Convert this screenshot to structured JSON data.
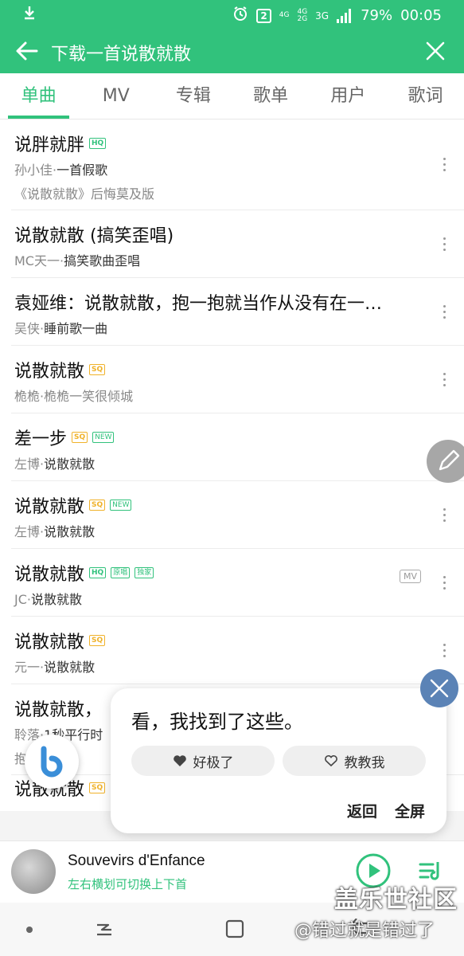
{
  "status_bar": {
    "icons": [
      "download-icon",
      "alarm-icon",
      "sim-icon",
      "signal-icon"
    ],
    "sim_badge": "2",
    "net1_top": "4G",
    "net1_bottom": "",
    "net2_top": "4G",
    "net2_bottom": "2G",
    "net3": "3G",
    "battery": "79%",
    "time": "00:05"
  },
  "header": {
    "title": "下载一首说散就散",
    "accent_color": "#31c27c"
  },
  "tabs": [
    {
      "label": "单曲",
      "active": true
    },
    {
      "label": "MV"
    },
    {
      "label": "专辑"
    },
    {
      "label": "歌单"
    },
    {
      "label": "用户"
    },
    {
      "label": "歌词"
    }
  ],
  "songs": [
    {
      "title": "说胖就胖",
      "tags": [
        "HQ"
      ],
      "artist": "孙小佳·",
      "album": "一首假歌",
      "extra": "《说散就散》后悔莫及版"
    },
    {
      "title": "说散就散 (搞笑歪唱)",
      "tags": [],
      "artist": "MC天一·",
      "album": "搞笑歌曲歪唱"
    },
    {
      "title": "袁娅维：说散就散，抱一抱就当作从没有在一…",
      "tags": [],
      "artist": "吴侠·",
      "album": "睡前歌一曲"
    },
    {
      "title": "说散就散",
      "tags": [
        "SQ"
      ],
      "artist": "桅桅·",
      "album": "桅桅一笑很倾城"
    },
    {
      "title": "差一步",
      "tags": [
        "SQ",
        "NEW"
      ],
      "artist": "左博·",
      "album": "说散就散"
    },
    {
      "title": "说散就散",
      "tags": [
        "SQ",
        "NEW"
      ],
      "artist": "左博·",
      "album": "说散就散"
    },
    {
      "title": "说散就散",
      "tags": [
        "HQ",
        "原唱",
        "独家"
      ],
      "artist": "JC·",
      "album": "说散就散",
      "mv": "MV"
    },
    {
      "title": "说散就散",
      "tags": [
        "SQ"
      ],
      "artist": "元一·",
      "album": "说散就散"
    },
    {
      "title": "说散就散，",
      "tags": [],
      "artist": "聆落·",
      "album": "1秒平行时",
      "extra": "抱一抱再抱"
    },
    {
      "title": "说散就散",
      "tags": [
        "SQ"
      ],
      "artist": "",
      "album": ""
    }
  ],
  "bixby_card": {
    "message": "看，我找到了这些。",
    "like_label": "好极了",
    "teach_label": "教教我",
    "back_label": "返回",
    "fullscreen_label": "全屏"
  },
  "player": {
    "song": "Souvevirs d'Enfance",
    "hint": "左右横划可切换上下首"
  },
  "watermark": {
    "line1": "盖乐世社区",
    "line2": "@错过就是错过了"
  }
}
